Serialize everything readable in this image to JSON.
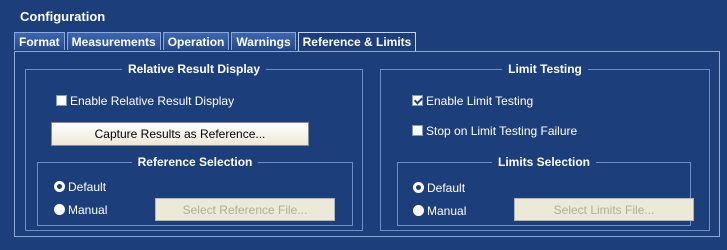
{
  "window": {
    "title": "Configuration"
  },
  "tabs": [
    {
      "label": "Format",
      "active": false
    },
    {
      "label": "Measurements",
      "active": false
    },
    {
      "label": "Operation",
      "active": false
    },
    {
      "label": "Warnings",
      "active": false
    },
    {
      "label": "Reference & Limits",
      "active": true
    }
  ],
  "relative": {
    "legend": "Relative Result Display",
    "enable_label": "Enable Relative Result Display",
    "enable_checked": false,
    "capture_label": "Capture Results as Reference..."
  },
  "reference_selection": {
    "legend": "Reference Selection",
    "default_label": "Default",
    "manual_label": "Manual",
    "selected": "Default",
    "select_file_label": "Select Reference File..."
  },
  "limit_testing": {
    "legend": "Limit Testing",
    "enable_label": "Enable Limit Testing",
    "enable_checked": true,
    "stop_label": "Stop on Limit Testing Failure",
    "stop_checked": false
  },
  "limits_selection": {
    "legend": "Limits Selection",
    "default_label": "Default",
    "manual_label": "Manual",
    "selected": "Default",
    "select_file_label": "Select Limits File..."
  },
  "colors": {
    "background": "#1c3f7c",
    "border": "#8fa8d8",
    "text": "#ffffff"
  }
}
